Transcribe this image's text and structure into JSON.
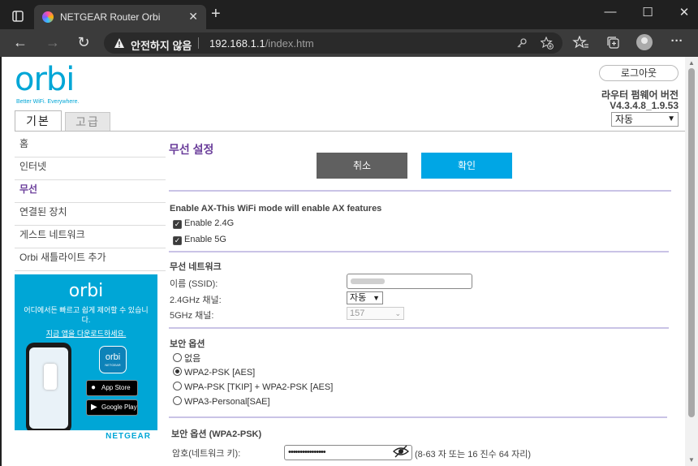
{
  "browser": {
    "tab_title": "NETGEAR Router Orbi",
    "tab_close": "✕",
    "new_tab": "+",
    "window_controls": {
      "minimize": "—",
      "maximize": "☐",
      "close": "✕"
    },
    "nav": {
      "back": "←",
      "forward": "→",
      "reload": "↻"
    },
    "security_warning": "안전하지 않음",
    "url_host": "192.168.1.1",
    "url_path": "/index.htm",
    "toolbar_icons": [
      "key-icon",
      "add-favorite-icon",
      "favorites-icon",
      "collections-icon",
      "profile-icon",
      "more-icon"
    ],
    "more": "···"
  },
  "header": {
    "logo": "orbi",
    "tagline": "Better WiFi. Everywhere.",
    "tabs": [
      {
        "label": "기본",
        "active": true
      },
      {
        "label": "고급",
        "active": false
      }
    ],
    "logout_label": "로그아웃",
    "firmware_label": "라우터 펌웨어 버전",
    "firmware_version": "V4.3.4.8_1.9.53",
    "language_value": "자동"
  },
  "sidebar": {
    "items": [
      {
        "label": "홈",
        "active": false
      },
      {
        "label": "인터넷",
        "active": false
      },
      {
        "label": "무선",
        "active": true
      },
      {
        "label": "연결된 장치",
        "active": false
      },
      {
        "label": "게스트 네트워크",
        "active": false
      },
      {
        "label": "Orbi 새틀라이트 추가",
        "active": false
      }
    ],
    "promo": {
      "logo": "orbi",
      "text": "어디에서든 빠르고 쉽게 제어할 수 있습니다.",
      "link": "지금 앱을 다운로드하세요.",
      "app_icon_label": "orbi",
      "app_icon_brand": "NETGEAR",
      "app_store": "App Store",
      "google_play": "Google Play",
      "brand": "NETGEAR"
    }
  },
  "main": {
    "title": "무선 설정",
    "cancel_label": "취소",
    "apply_label": "확인",
    "ax_heading": "Enable AX-This WiFi mode will enable AX features",
    "enable_24": {
      "label": "Enable 2.4G",
      "checked": true
    },
    "enable_5": {
      "label": "Enable 5G",
      "checked": true
    },
    "wireless_network": {
      "heading": "무선 네트워크",
      "ssid_label": "이름 (SSID):",
      "ch24_label": "2.4GHz 채널:",
      "ch24_value": "자동",
      "ch5_label": "5GHz 채널:",
      "ch5_value": "157"
    },
    "security": {
      "heading": "보안 옵션",
      "options": [
        {
          "label": "없음",
          "selected": false
        },
        {
          "label": "WPA2-PSK [AES]",
          "selected": true
        },
        {
          "label": "WPA-PSK [TKIP] + WPA2-PSK [AES]",
          "selected": false
        },
        {
          "label": "WPA3-Personal[SAE]",
          "selected": false
        }
      ]
    },
    "security_wpa2": {
      "heading": "보안 옵션 (WPA2-PSK)",
      "password_label": "암호(네트워크 키):",
      "password_mask": "••••••••••••••••",
      "hint": "(8-63 자 또는 16 진수 64 자리)"
    }
  },
  "colors": {
    "accent_cyan": "#00a6d6",
    "apply_button": "#00a6e5",
    "cancel_button": "#606060",
    "title_purple": "#6a3d9a",
    "divider_lavender": "#c9c3e6"
  }
}
